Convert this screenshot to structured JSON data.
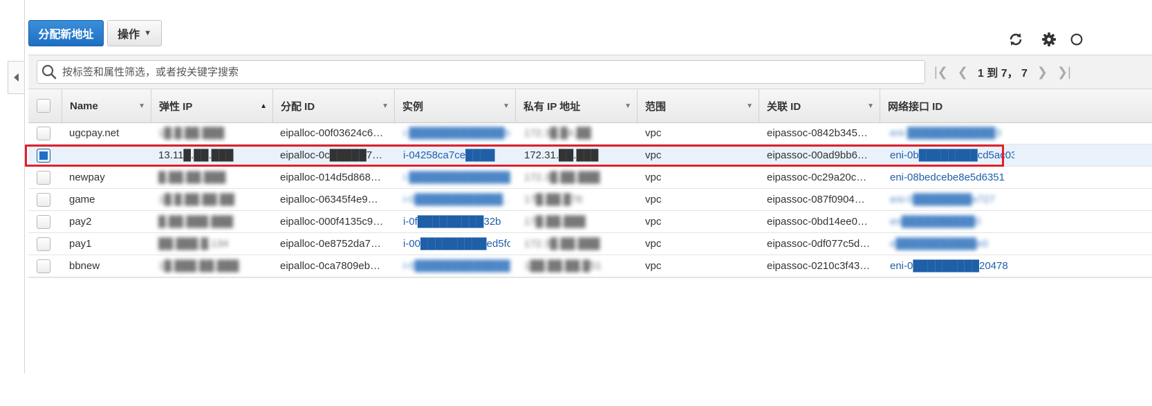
{
  "toolbar": {
    "allocate_label": "分配新地址",
    "actions_label": "操作"
  },
  "icons": {
    "refresh": "refresh-icon",
    "settings": "gear-icon",
    "help": "help-icon",
    "search": "search-icon",
    "collapse": "chevron-left-icon"
  },
  "search": {
    "placeholder": "按标签和属性筛选，或者按关键字搜索"
  },
  "pager": {
    "text": "1 到 7， 7"
  },
  "columns": [
    "Name",
    "弹性 IP",
    "分配 ID",
    "实例",
    "私有 IP 地址",
    "范围",
    "关联 ID",
    "网络接口 ID"
  ],
  "rows": [
    {
      "name": "ugcpay.net",
      "eip": "1█.█.██.███",
      "alloc": "eipalloc-00f03624c6…",
      "instance": "i-█████████████b4",
      "private_ip": "172.3█.█4.██",
      "scope": "vpc",
      "assoc": "eipassoc-0842b345…",
      "eni": "eni-████████████3"
    },
    {
      "name": "",
      "eip": "13.11█.██.███",
      "alloc": "eipalloc-0c█████7…",
      "instance": "i-04258ca7ce████",
      "private_ip": "172.31.██.███",
      "scope": "vpc",
      "assoc": "eipassoc-00ad9bb6…",
      "eni": "eni-0b████████cd5ac03",
      "selected": true
    },
    {
      "name": "newpay",
      "eip": "█.██.██.███",
      "alloc": "eipalloc-014d5d868…",
      "instance": "i-███████████████",
      "private_ip": "172.3█.██.███",
      "scope": "vpc",
      "assoc": "eipassoc-0c29a20c…",
      "eni": "eni-08bedcebe8e5d6351"
    },
    {
      "name": "game",
      "eip": "1█.█.██.██.██",
      "alloc": "eipalloc-06345f4e9…",
      "instance": "i-0████████████…",
      "private_ip": "17█.██.█76",
      "scope": "vpc",
      "assoc": "eipassoc-087f0904…",
      "eni": "eni-0████████e727"
    },
    {
      "name": "pay2",
      "eip": "█.██.███.███",
      "alloc": "eipalloc-000f4135c9…",
      "instance": "i-0f█████████32b",
      "private_ip": "17█.██.███",
      "scope": "vpc",
      "assoc": "eipassoc-0bd14ee0…",
      "eni": "en██████████0"
    },
    {
      "name": "pay1",
      "eip": "██.███.█.134",
      "alloc": "eipalloc-0e8752da7…",
      "instance": "i-00█████████ed5fc",
      "private_ip": "172.3█.██.███",
      "scope": "vpc",
      "assoc": "eipassoc-0df077c5d…",
      "eni": "e███████████e0"
    },
    {
      "name": "bbnew",
      "eip": "1█.███.██.███",
      "alloc": "eipalloc-0ca7809eb…",
      "instance": "i-0█████████████",
      "private_ip": "1██.██.██.█51",
      "scope": "vpc",
      "assoc": "eipassoc-0210c3f43…",
      "eni": "eni-0█████████20478"
    }
  ]
}
